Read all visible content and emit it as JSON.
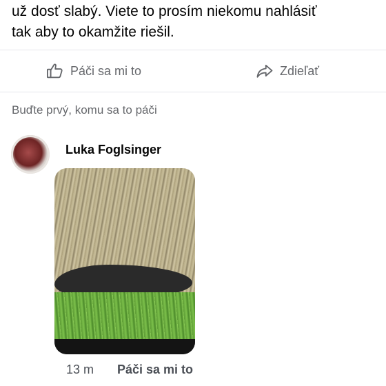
{
  "post": {
    "text": "už dosť slabý. Viete to prosím niekomu nahlásiť\ntak aby to okamžite riešil."
  },
  "actions": {
    "like_label": "Páči sa mi to",
    "share_label": "Zdieľať"
  },
  "reactions": {
    "summary": "Buďte prvý, komu sa to páči"
  },
  "comment": {
    "author": "Luka Foglsinger",
    "time": "13 m",
    "like_label": "Páči sa mi to"
  },
  "icons": {
    "like": "thumbs-up-icon",
    "share": "share-arrow-icon"
  },
  "colors": {
    "secondary_text": "#65676b",
    "divider": "#e4e6eb"
  }
}
